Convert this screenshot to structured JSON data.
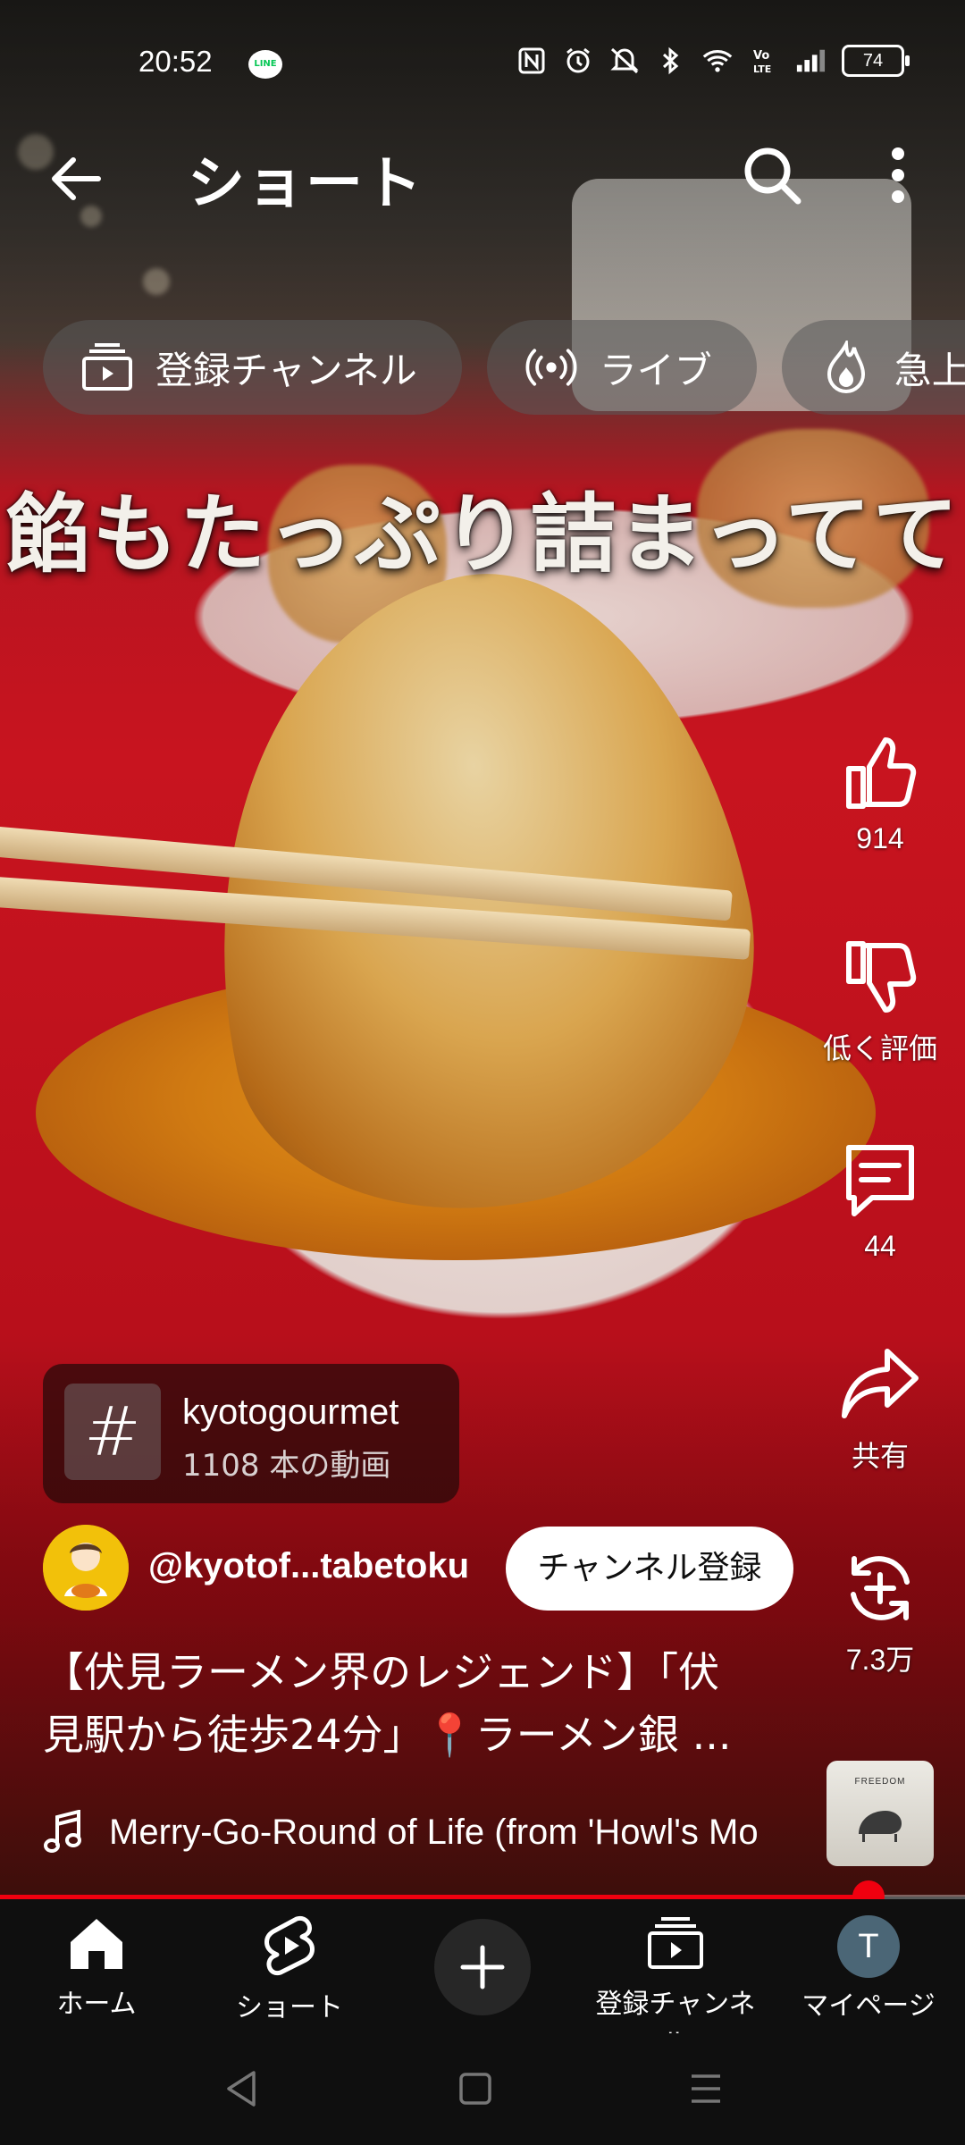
{
  "status_bar": {
    "time": "20:52",
    "line_badge": "LINE",
    "battery": "74",
    "icons": [
      "line-icon",
      "nfc-icon",
      "alarm-icon",
      "mute-icon",
      "bluetooth-icon",
      "wifi-icon",
      "volte-icon",
      "signal-icon",
      "battery-icon"
    ]
  },
  "header": {
    "title": "ショート",
    "back_icon": "arrow-left-icon",
    "search_icon": "search-icon",
    "more_icon": "more-vert-icon"
  },
  "chips": [
    {
      "label": "登録チャンネル",
      "icon": "subscriptions-icon"
    },
    {
      "label": "ライブ",
      "icon": "live-icon"
    },
    {
      "label": "急上昇",
      "icon": "trending-icon"
    }
  ],
  "video": {
    "caption_overlay": "餡もたっぷり詰まってて"
  },
  "actions": {
    "like_count": "914",
    "dislike_label": "低く評価",
    "comment_count": "44",
    "share_label": "共有",
    "remix_count": "7.3万"
  },
  "hashtag": {
    "symbol": "#",
    "name": "kyotogourmet",
    "count": "1108 本の動画"
  },
  "channel": {
    "handle": "@kyotof...tabetoku",
    "subscribe_label": "チャンネル登録"
  },
  "title": {
    "line1": "【伏見ラーメン界のレジェンド】「伏",
    "line2": "見駅から徒歩24分」📍ラーメン銀 ..."
  },
  "music": {
    "text": "Merry-Go-Round of Life (from 'Howl's Mo",
    "album_label": "FREEDOM"
  },
  "progress": {
    "fraction": 0.9
  },
  "bottom_nav": [
    {
      "label": "ホーム",
      "icon": "home-icon"
    },
    {
      "label": "ショート",
      "icon": "shorts-icon"
    },
    {
      "label": "",
      "icon": "create-plus-icon"
    },
    {
      "label": "登録チャンネル",
      "icon": "subscriptions-icon"
    },
    {
      "label": "マイページ",
      "icon": "avatar"
    }
  ],
  "me_initial": "T",
  "colors": {
    "accent_red": "#f0000f",
    "nav_bg": "#0f0f0f",
    "chip_bg": "#5a5a5a",
    "avatar_me": "#4b6676"
  }
}
